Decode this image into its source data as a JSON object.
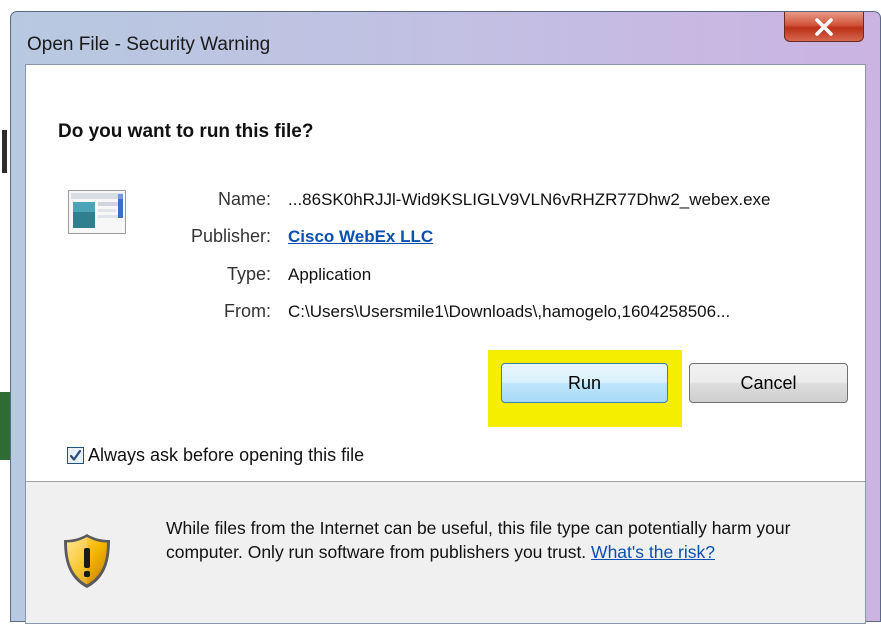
{
  "window": {
    "title": "Open File - Security Warning",
    "close_label": "X"
  },
  "dialog": {
    "heading": "Do you want to run this file?",
    "fields": {
      "name_label": "Name:",
      "name_value": "...86SK0hRJJl-Wid9KSLIGLV9VLN6vRHZR77Dhw2_webex.exe",
      "publisher_label": "Publisher:",
      "publisher_value": "Cisco WebEx LLC",
      "type_label": "Type:",
      "type_value": "Application",
      "from_label": "From:",
      "from_value": "C:\\Users\\Usersmile1\\Downloads\\,hamogelo,1604258506..."
    },
    "buttons": {
      "run_label": "Run",
      "cancel_label": "Cancel"
    },
    "checkbox": {
      "label": "Always ask before opening this file",
      "checked": true
    },
    "warning": {
      "text": "While files from the Internet can be useful, this file type can potentially harm your computer. Only run software from publishers you trust.",
      "link_text": "What's the risk?"
    }
  },
  "colors": {
    "highlight": "#f5ee00",
    "link": "#0b4fb0",
    "title_bar_start": "#b7c9e0",
    "title_bar_end": "#cbb3e2",
    "close_button": "#c9452c"
  }
}
